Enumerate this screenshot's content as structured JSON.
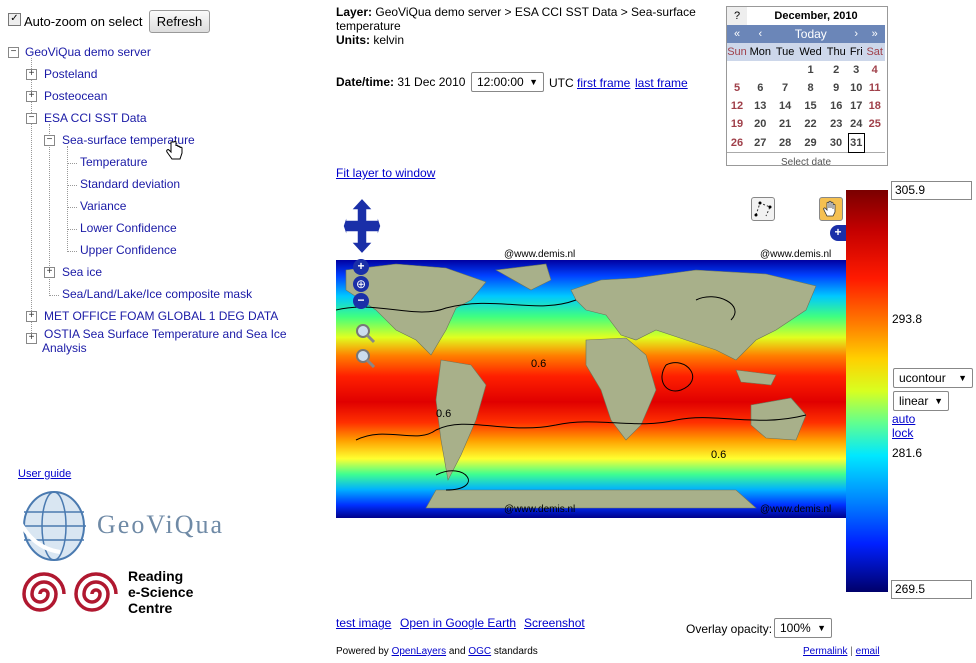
{
  "sidebar": {
    "autozoom_label": "Auto-zoom on select",
    "refresh_label": "Refresh",
    "tree": {
      "root": "GeoViQua demo server",
      "posteland": "Posteland",
      "posteocean": "Posteocean",
      "esa_cci": "ESA CCI SST Data",
      "sst": "Sea-surface temperature",
      "temperature": "Temperature",
      "std_dev": "Standard deviation",
      "variance": "Variance",
      "lower_conf": "Lower Confidence",
      "upper_conf": "Upper Confidence",
      "sea_ice": "Sea ice",
      "mask": "Sea/Land/Lake/Ice composite mask",
      "met_office": "MET OFFICE FOAM GLOBAL 1 DEG DATA",
      "ostia_line1": "OSTIA Sea Surface Temperature and Sea Ice",
      "ostia_line2": "Analysis"
    },
    "user_guide": "User guide",
    "geoviqua_logo": "GeoViQua",
    "resc_line1": "Reading",
    "resc_line2": "e-Science",
    "resc_line3": "Centre"
  },
  "info": {
    "layer_label": "Layer:",
    "layer_value_1": "GeoViQua demo server > ESA CCI SST Data > Sea-surface",
    "layer_value_2": "temperature",
    "units_label": "Units:",
    "units_value": "kelvin",
    "datetime_label": "Date/time:",
    "date_value": "31 Dec 2010",
    "time_value": "12:00:00",
    "utc": "UTC",
    "first_frame": "first frame",
    "last_frame": "last frame",
    "fit_layer": "Fit layer to window"
  },
  "calendar": {
    "help": "?",
    "month": "December, 2010",
    "prev_year": "«",
    "prev_month": "‹",
    "today": "Today",
    "next_month": "›",
    "next_year": "»",
    "dow": [
      "Sun",
      "Mon",
      "Tue",
      "Wed",
      "Thu",
      "Fri",
      "Sat"
    ],
    "weeks": [
      [
        "",
        "",
        "",
        "1",
        "2",
        "3",
        "4"
      ],
      [
        "5",
        "6",
        "7",
        "8",
        "9",
        "10",
        "11"
      ],
      [
        "12",
        "13",
        "14",
        "15",
        "16",
        "17",
        "18"
      ],
      [
        "19",
        "20",
        "21",
        "22",
        "23",
        "24",
        "25"
      ],
      [
        "26",
        "27",
        "28",
        "29",
        "30",
        "31",
        ""
      ]
    ],
    "footer": "Select date"
  },
  "map": {
    "credit": "@www.demis.nl",
    "contour_label": "0.6"
  },
  "colorbar": {
    "max": "305.9",
    "mid_high": "293.8",
    "mid_low": "281.6",
    "min": "269.5",
    "style": "ucontour",
    "scale": "linear",
    "auto": "auto",
    "lock": "lock"
  },
  "footer": {
    "test_image": "test image",
    "google_earth": "Open in Google Earth",
    "screenshot": "Screenshot",
    "opacity_label": "Overlay opacity:",
    "opacity_value": "100%",
    "powered_prefix": "Powered by",
    "openlayers": "OpenLayers",
    "and": "and",
    "ogc": "OGC",
    "standards": "standards",
    "permalink": "Permalink",
    "sep": "|",
    "email": "email"
  }
}
